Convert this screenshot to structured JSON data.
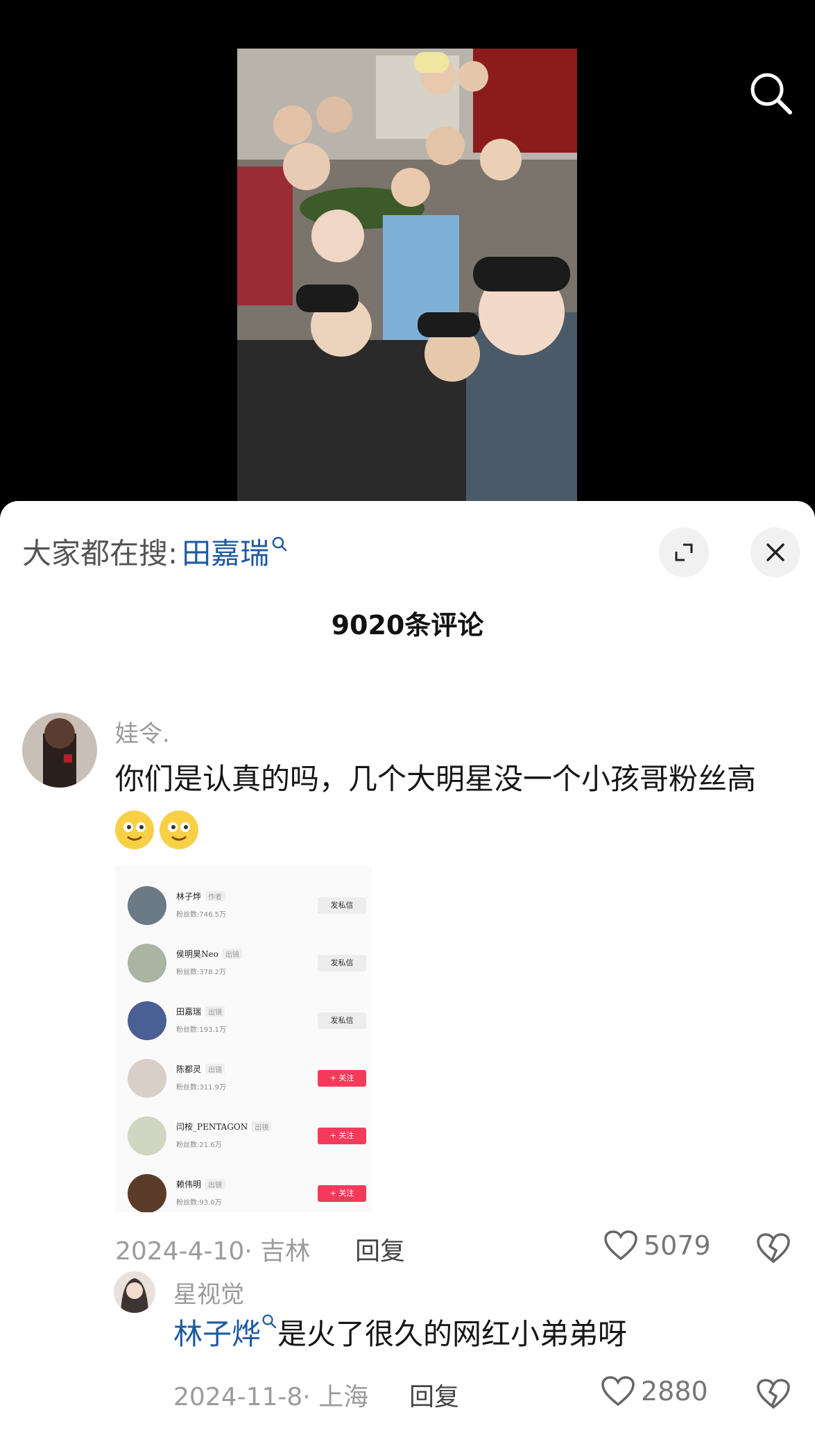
{
  "video": {
    "search_icon": "search-icon"
  },
  "panel": {
    "hot_search_prefix": "大家都在搜:",
    "hot_search_term": "田嘉瑞",
    "comment_count": "9020条评论"
  },
  "comments": [
    {
      "author": "娃令.",
      "text": "你们是认真的吗，几个大明星没一个小孩哥粉丝高",
      "emoji_count": 2,
      "date_location": "2024-4-10· 吉林",
      "reply": "回复",
      "likes": "5079",
      "attachment": {
        "rows": [
          {
            "name": "林子烨",
            "tag": "作者",
            "fans": "粉丝数:746.5万",
            "action": "发私信",
            "style": "gray"
          },
          {
            "name": "侯明昊Neo",
            "tag": "出镜",
            "fans": "粉丝数:378.2万",
            "action": "发私信",
            "style": "gray"
          },
          {
            "name": "田嘉瑞",
            "tag": "出镜",
            "fans": "粉丝数:193.1万",
            "action": "发私信",
            "style": "gray"
          },
          {
            "name": "陈都灵",
            "tag": "出镜",
            "fans": "粉丝数:311.9万",
            "action": "+ 关注",
            "style": "red"
          },
          {
            "name": "闫桉_PENTAGON",
            "tag": "出镜",
            "fans": "粉丝数:21.6万",
            "action": "+ 关注",
            "style": "red"
          },
          {
            "name": "赖伟明",
            "tag": "出镜",
            "fans": "粉丝数:93.0万",
            "action": "+ 关注",
            "style": "red"
          }
        ]
      }
    },
    {
      "author": "星视觉",
      "mention": "林子烨",
      "text": "是火了很久的网红小弟弟呀",
      "date_location": "2024-11-8· 上海",
      "reply": "回复",
      "likes": "2880"
    }
  ]
}
